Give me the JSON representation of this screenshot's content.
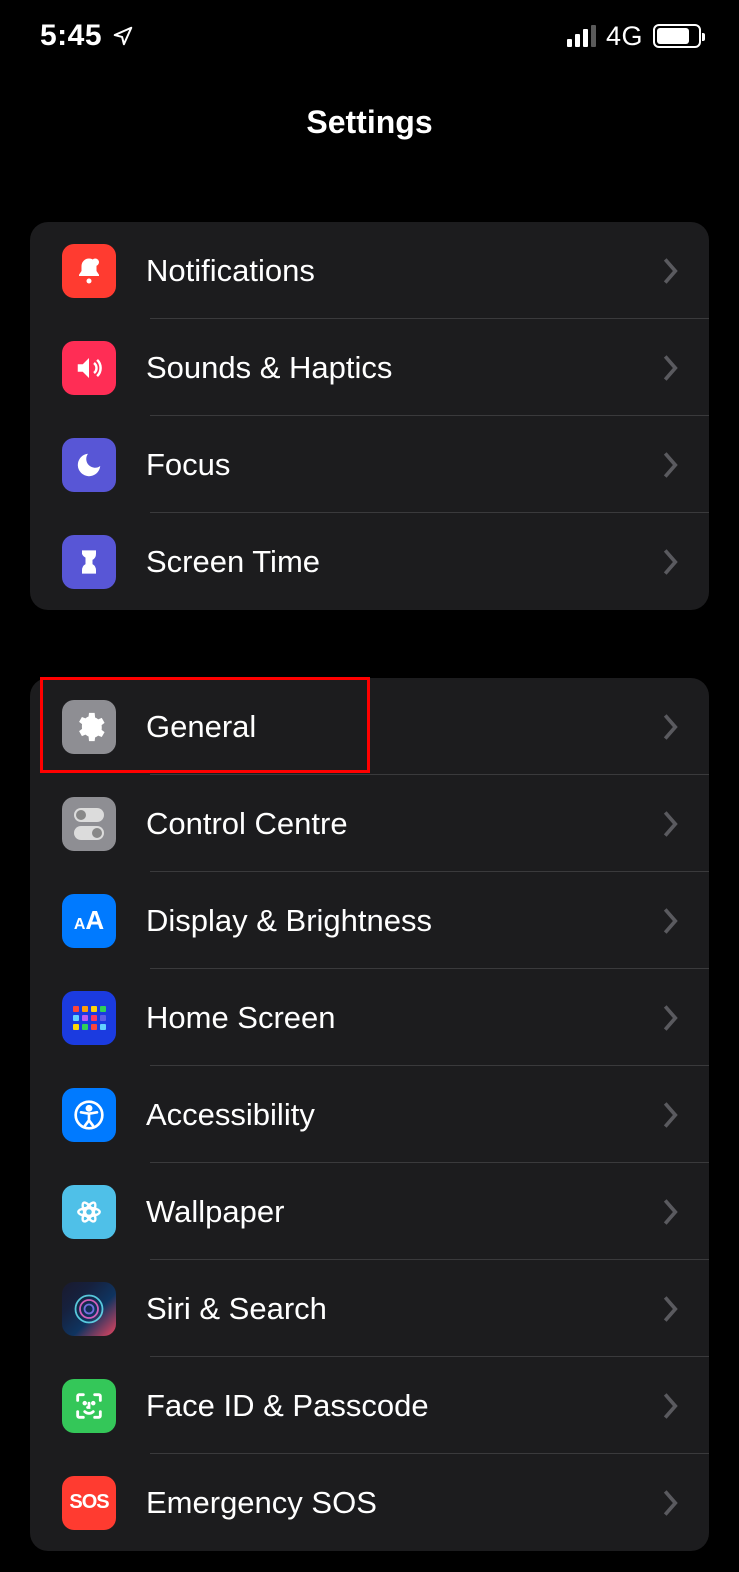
{
  "statusBar": {
    "time": "5:45",
    "network": "4G"
  },
  "header": {
    "title": "Settings"
  },
  "sections": [
    {
      "rows": [
        {
          "label": "Notifications"
        },
        {
          "label": "Sounds & Haptics"
        },
        {
          "label": "Focus"
        },
        {
          "label": "Screen Time"
        }
      ]
    },
    {
      "rows": [
        {
          "label": "General"
        },
        {
          "label": "Control Centre"
        },
        {
          "label": "Display & Brightness"
        },
        {
          "label": "Home Screen"
        },
        {
          "label": "Accessibility"
        },
        {
          "label": "Wallpaper"
        },
        {
          "label": "Siri & Search"
        },
        {
          "label": "Face ID & Passcode"
        },
        {
          "label": "Emergency SOS"
        }
      ]
    }
  ]
}
